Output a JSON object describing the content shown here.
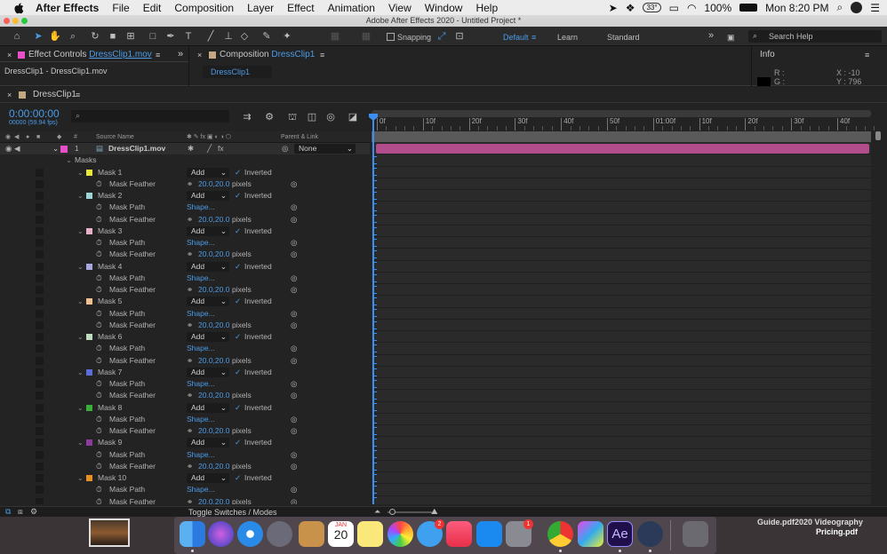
{
  "menubar": {
    "app": "After Effects",
    "items": [
      "File",
      "Edit",
      "Composition",
      "Layer",
      "Effect",
      "Animation",
      "View",
      "Window",
      "Help"
    ],
    "temp": "33°",
    "battery": "100%",
    "clock": "Mon 8:20 PM"
  },
  "window": {
    "title": "Adobe After Effects 2020 - Untitled Project *"
  },
  "toolbar": {
    "snapping": "Snapping",
    "workspaces": [
      "Default",
      "Learn",
      "Standard"
    ],
    "search_placeholder": "Search Help"
  },
  "panels": {
    "effect_controls_tab": "Effect Controls",
    "effect_controls_file": "DressClip1.mov",
    "effect_controls_sub": "DressClip1 - DressClip1.mov",
    "composition_tab": "Composition",
    "composition_name": "DressClip1",
    "composition_sub": "DressClip1",
    "info_tab": "Info",
    "info_r": "R :",
    "info_g": "G :",
    "info_x": "X : -10",
    "info_y": "Y : 796"
  },
  "timeline": {
    "tab": "DressClip1",
    "timecode": "0:00:00:00",
    "fps": "00000 (59.94 fps)",
    "col_num": "#",
    "col_source": "Source Name",
    "col_parent": "Parent & Link",
    "layer_num": "1",
    "layer_name": "DressClip1.mov",
    "parent_value": "None",
    "masks_label": "Masks",
    "toggle_label": "Toggle Switches / Modes",
    "ruler_labels": [
      "0f",
      "10f",
      "20f",
      "30f",
      "40f",
      "50f",
      "01:00f",
      "10f",
      "20f",
      "30f",
      "40f"
    ]
  },
  "masks": [
    {
      "name": "Mask 1",
      "color": "#e8e83a",
      "mode": "Add",
      "inverted": "Inverted",
      "feather": "20.0,20.0",
      "unit": "pixels",
      "path": ""
    },
    {
      "name": "Mask 2",
      "color": "#9bd4d4",
      "mode": "Add",
      "inverted": "Inverted",
      "feather": "20.0,20.0",
      "unit": "pixels",
      "path": "Shape..."
    },
    {
      "name": "Mask 3",
      "color": "#e8b0c8",
      "mode": "Add",
      "inverted": "Inverted",
      "feather": "20.0,20.0",
      "unit": "pixels",
      "path": "Shape..."
    },
    {
      "name": "Mask 4",
      "color": "#a8a8e0",
      "mode": "Add",
      "inverted": "Inverted",
      "feather": "20.0,20.0",
      "unit": "pixels",
      "path": "Shape..."
    },
    {
      "name": "Mask 5",
      "color": "#f0c090",
      "mode": "Add",
      "inverted": "Inverted",
      "feather": "20.0,20.0",
      "unit": "pixels",
      "path": "Shape..."
    },
    {
      "name": "Mask 6",
      "color": "#c0dcc0",
      "mode": "Add",
      "inverted": "Inverted",
      "feather": "20.0,20.0",
      "unit": "pixels",
      "path": "Shape..."
    },
    {
      "name": "Mask 7",
      "color": "#5c6cd8",
      "mode": "Add",
      "inverted": "Inverted",
      "feather": "20.0,20.0",
      "unit": "pixels",
      "path": "Shape..."
    },
    {
      "name": "Mask 8",
      "color": "#38b038",
      "mode": "Add",
      "inverted": "Inverted",
      "feather": "20.0,20.0",
      "unit": "pixels",
      "path": "Shape..."
    },
    {
      "name": "Mask 9",
      "color": "#8e3a9e",
      "mode": "Add",
      "inverted": "Inverted",
      "feather": "20.0,20.0",
      "unit": "pixels",
      "path": "Shape..."
    },
    {
      "name": "Mask 10",
      "color": "#e89020",
      "mode": "Add",
      "inverted": "Inverted",
      "feather": "20.0,20.0",
      "unit": "pixels",
      "path": "Shape..."
    }
  ],
  "labels": {
    "mask_path": "Mask Path",
    "mask_feather": "Mask Feather"
  },
  "desktop": {
    "file_label_1": "Guide.pdf2020 Videography",
    "file_label_2": "Pricing.pdf",
    "calendar_month": "JAN",
    "calendar_day": "20",
    "messages_badge": "2",
    "prefs_badge": "1",
    "ae_label": "Ae"
  },
  "colors": {
    "accent": "#4b9be8",
    "layer_bar": "#b04d8a",
    "playhead": "#3a8ff0"
  }
}
